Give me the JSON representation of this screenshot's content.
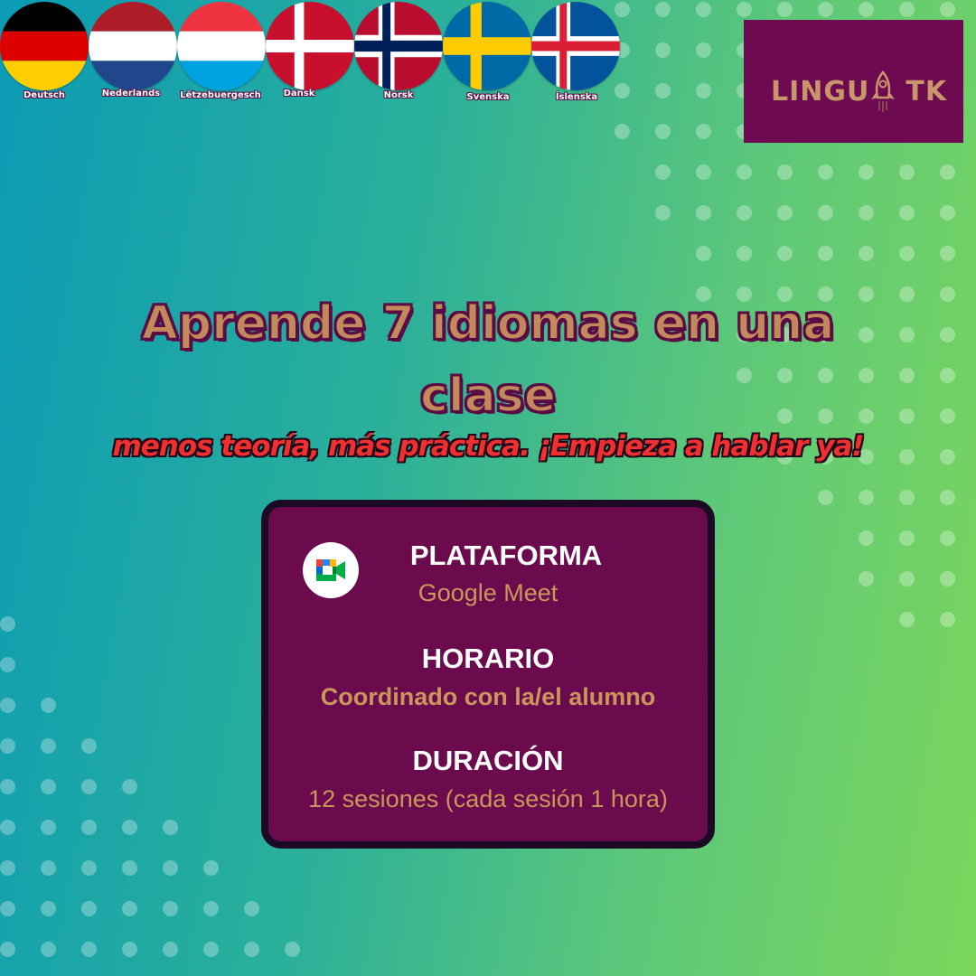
{
  "flags": [
    {
      "label": "Deutsch",
      "icon": "germany-flag-icon"
    },
    {
      "label": "Nederlands",
      "icon": "netherlands-flag-icon"
    },
    {
      "label": "Lëtzebuergesch",
      "icon": "luxembourg-flag-icon"
    },
    {
      "label": "Dansk",
      "icon": "denmark-flag-icon"
    },
    {
      "label": "Norsk",
      "icon": "norway-flag-icon"
    },
    {
      "label": "Svenska",
      "icon": "sweden-flag-icon"
    },
    {
      "label": "Íslenska",
      "icon": "iceland-flag-icon"
    }
  ],
  "logo": {
    "text_left": "LINGU",
    "text_right": "TK",
    "icon": "rocket-icon"
  },
  "headline": {
    "line1": "Aprende 7 idiomas en una",
    "line2": "clase"
  },
  "subtitle": "menos teoría, más práctica. ¡Empieza a hablar ya!",
  "info": {
    "platform_title": "PLATAFORMA",
    "platform_value": "Google Meet",
    "platform_icon": "google-meet-icon",
    "schedule_title": "HORARIO",
    "schedule_value": "Coordinado con la/el alumno",
    "duration_title": "DURACIÓN",
    "duration_value": "12 sesiones (cada sesión 1 hora)"
  },
  "colors": {
    "card_bg": "#6b0b4d",
    "accent_gold": "#c9975c",
    "subtitle_red": "#f03030"
  }
}
